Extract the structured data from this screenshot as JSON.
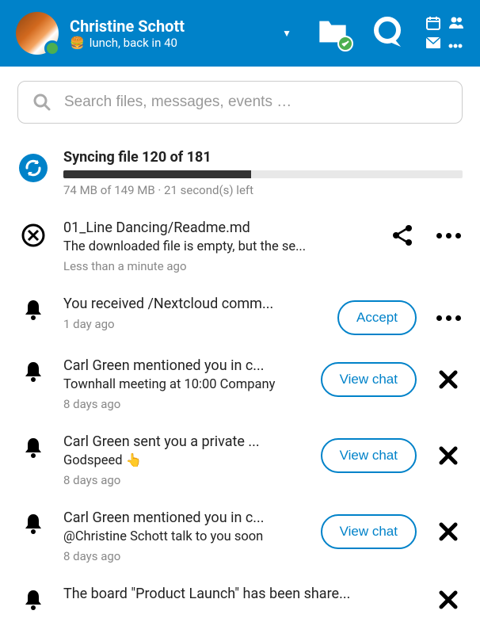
{
  "header": {
    "user_name": "Christine Schott",
    "status_emoji": "🍔",
    "status_text": "lunch, back in 40"
  },
  "search": {
    "placeholder": "Search files, messages, events …"
  },
  "sync": {
    "title": "Syncing file 120 of 181",
    "progress_pct": 47,
    "meta": "74 MB of 149 MB · 21 second(s) left"
  },
  "items": [
    {
      "title": "01_Line Dancing/Readme.md",
      "sub": "The downloaded file is empty, but the se...",
      "meta": "Less than a minute ago",
      "action": null
    },
    {
      "title": "You received /Nextcloud comm...",
      "sub": null,
      "meta": "1 day ago",
      "action": "Accept"
    },
    {
      "title": "Carl Green mentioned you in c...",
      "sub": "Townhall meeting at 10:00 Company",
      "meta": "8 days ago",
      "action": "View chat"
    },
    {
      "title": "Carl Green sent you a private ...",
      "sub": "Godspeed 👆",
      "meta": "8 days ago",
      "action": "View chat"
    },
    {
      "title": "Carl Green mentioned you in c...",
      "sub": "@Christine Schott talk to you soon",
      "meta": "8 days ago",
      "action": "View chat"
    },
    {
      "title": "The board \"Product Launch\" has been share...",
      "sub": null,
      "meta": null,
      "action": null
    }
  ]
}
